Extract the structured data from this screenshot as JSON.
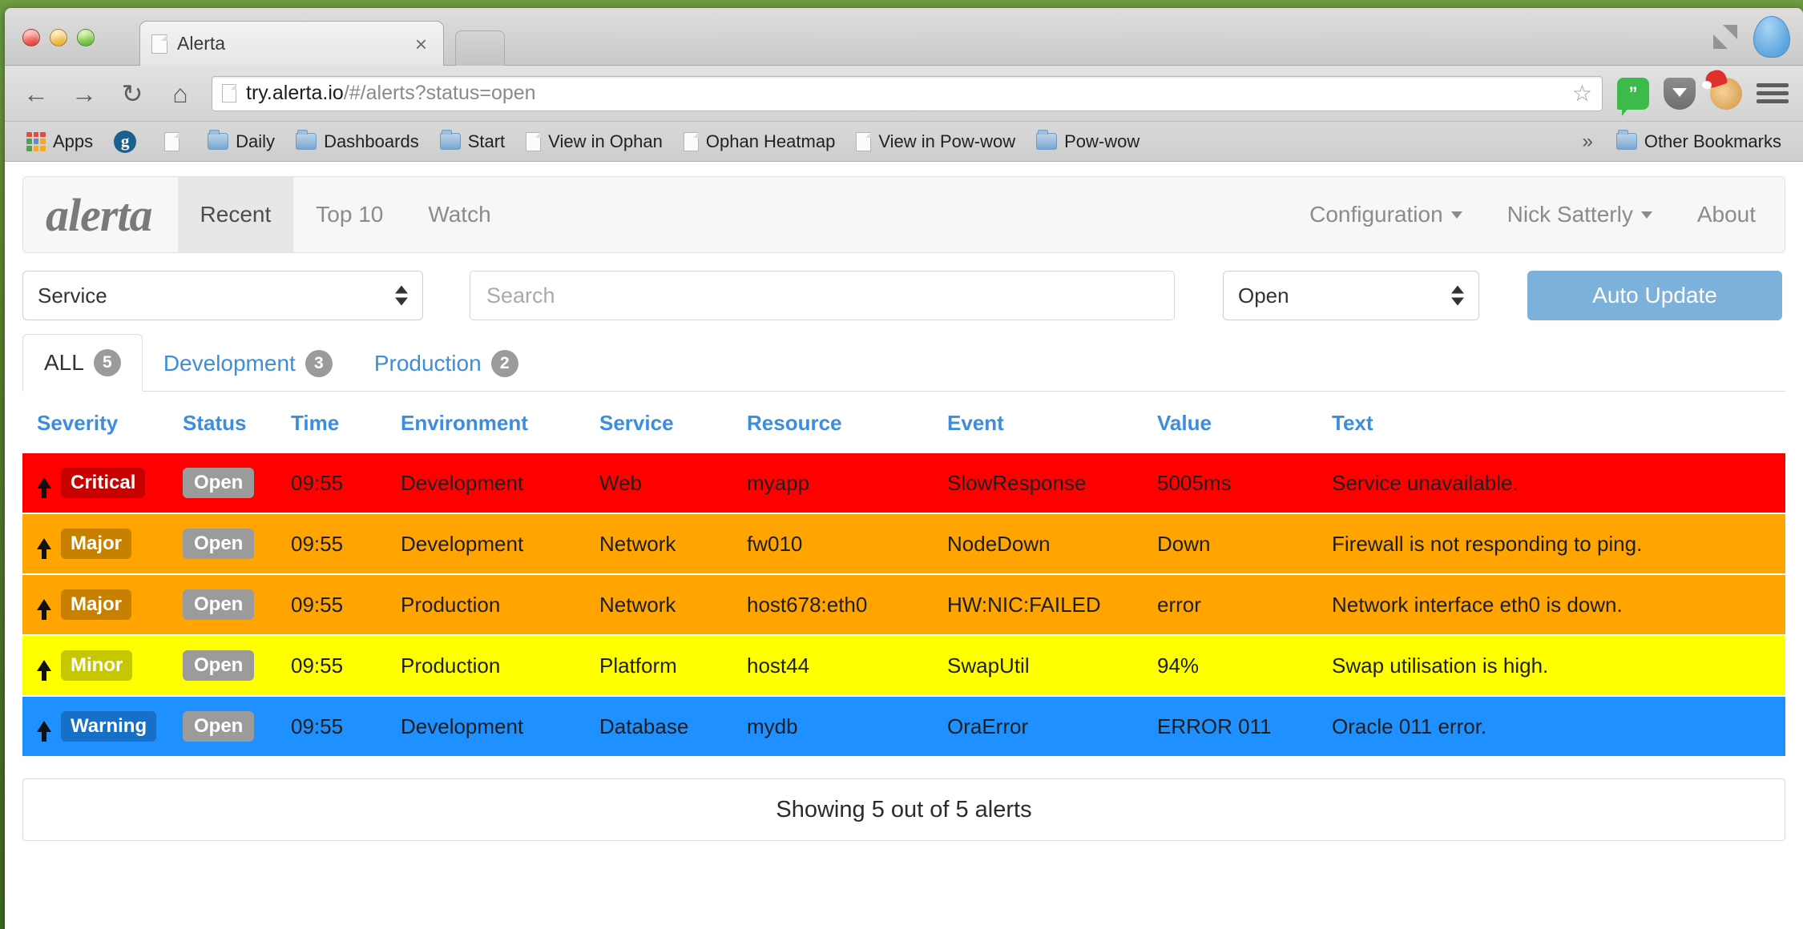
{
  "browser": {
    "tab": {
      "title": "Alerta",
      "close_label": "×"
    },
    "nav": {
      "back": "←",
      "forward": "→",
      "reload": "↻",
      "home": "⌂"
    },
    "omnibox": {
      "host": "try.alerta.io",
      "path": "/#/alerts?status=open",
      "star": "☆"
    },
    "toolbar_icons": [
      {
        "name": "hangouts-icon",
        "glyph": "”"
      },
      {
        "name": "pocket-icon",
        "glyph": ""
      },
      {
        "name": "cookie-icon",
        "glyph": ""
      },
      {
        "name": "chrome-menu-icon",
        "glyph": ""
      }
    ],
    "window_controls": {
      "maximize": "maximize-icon",
      "profile": "profile-avatar-icon"
    },
    "bookmarks": [
      {
        "label": "Apps",
        "icon": "apps-grid-icon"
      },
      {
        "label": "",
        "icon": "guardian-g-icon"
      },
      {
        "label": "",
        "icon": "document-icon"
      },
      {
        "label": "Daily",
        "icon": "folder-icon"
      },
      {
        "label": "Dashboards",
        "icon": "folder-icon"
      },
      {
        "label": "Start",
        "icon": "folder-icon"
      },
      {
        "label": "View in Ophan",
        "icon": "document-icon"
      },
      {
        "label": "Ophan Heatmap",
        "icon": "document-icon"
      },
      {
        "label": "View in Pow-wow",
        "icon": "document-icon"
      },
      {
        "label": "Pow-wow",
        "icon": "folder-icon"
      }
    ],
    "bookmarks_overflow": "»",
    "other_bookmarks": {
      "label": "Other Bookmarks",
      "icon": "folder-icon"
    }
  },
  "app": {
    "brand": "alerta",
    "nav_left": [
      {
        "label": "Recent",
        "active": true
      },
      {
        "label": "Top 10",
        "active": false
      },
      {
        "label": "Watch",
        "active": false
      }
    ],
    "nav_right": [
      {
        "label": "Configuration",
        "caret": true
      },
      {
        "label": "Nick Satterly",
        "caret": true
      },
      {
        "label": "About",
        "caret": false
      }
    ],
    "filters": {
      "service_select": "Service",
      "search_placeholder": "Search",
      "search_value": "",
      "status_select": "Open",
      "auto_update_label": "Auto Update"
    },
    "env_tabs": [
      {
        "label": "ALL",
        "count": "5",
        "active": true
      },
      {
        "label": "Development",
        "count": "3",
        "active": false
      },
      {
        "label": "Production",
        "count": "2",
        "active": false
      }
    ],
    "table": {
      "columns": [
        "Severity",
        "Status",
        "Time",
        "Environment",
        "Service",
        "Resource",
        "Event",
        "Value",
        "Text"
      ],
      "rows": [
        {
          "severity": "Critical",
          "severity_class": "sev-critical",
          "status": "Open",
          "time": "09:55",
          "environment": "Development",
          "service": "Web",
          "resource": "myapp",
          "event": "SlowResponse",
          "value": "5005ms",
          "text": "Service unavailable."
        },
        {
          "severity": "Major",
          "severity_class": "sev-major",
          "status": "Open",
          "time": "09:55",
          "environment": "Development",
          "service": "Network",
          "resource": "fw010",
          "event": "NodeDown",
          "value": "Down",
          "text": "Firewall is not responding to ping."
        },
        {
          "severity": "Major",
          "severity_class": "sev-major",
          "status": "Open",
          "time": "09:55",
          "environment": "Production",
          "service": "Network",
          "resource": "host678:eth0",
          "event": "HW:NIC:FAILED",
          "value": "error",
          "text": "Network interface eth0 is down."
        },
        {
          "severity": "Minor",
          "severity_class": "sev-minor",
          "status": "Open",
          "time": "09:55",
          "environment": "Production",
          "service": "Platform",
          "resource": "host44",
          "event": "SwapUtil",
          "value": "94%",
          "text": "Swap utilisation is high."
        },
        {
          "severity": "Warning",
          "severity_class": "sev-warning",
          "status": "Open",
          "time": "09:55",
          "environment": "Development",
          "service": "Database",
          "resource": "mydb",
          "event": "OraError",
          "value": "ERROR 011",
          "text": "Oracle 011 error."
        }
      ]
    },
    "footer": "Showing 5 out of 5 alerts",
    "colors": {
      "critical": "#ff0000",
      "major": "#ffa400",
      "minor": "#ffff00",
      "warning": "#1e90ff",
      "link": "#3d8ddd",
      "button": "#7cb1dc",
      "badge": "#9b9b9b"
    }
  }
}
